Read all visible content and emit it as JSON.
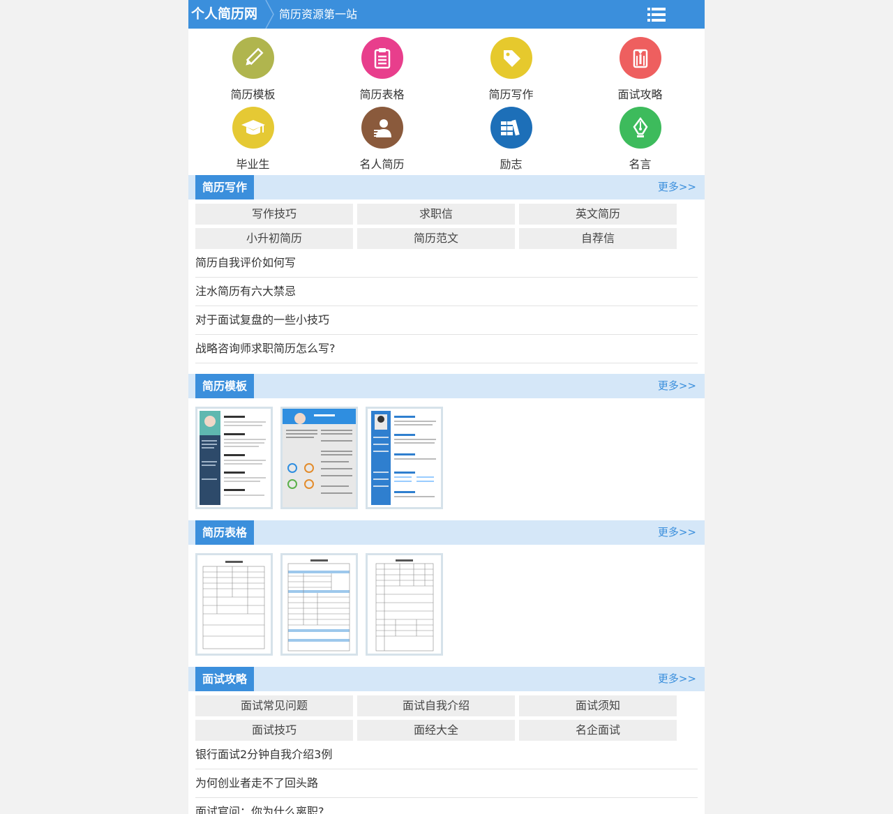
{
  "header": {
    "logo_text": "个人简历网",
    "tagline": "简历资源第一站",
    "menu_icon": "list-menu-icon"
  },
  "nav": [
    {
      "label": "简历模板",
      "icon": "pencil-icon",
      "color": "#b0b54e"
    },
    {
      "label": "简历表格",
      "icon": "clipboard-icon",
      "color": "#e83e8c"
    },
    {
      "label": "简历写作",
      "icon": "tag-icon",
      "color": "#e6c92d"
    },
    {
      "label": "面试攻略",
      "icon": "suit-icon",
      "color": "#ee5f5f"
    },
    {
      "label": "毕业生",
      "icon": "graduation-cap-icon",
      "color": "#e5c934"
    },
    {
      "label": "名人简历",
      "icon": "person-icon",
      "color": "#8a5a3c"
    },
    {
      "label": "励志",
      "icon": "books-icon",
      "color": "#1d6fb8"
    },
    {
      "label": "名言",
      "icon": "pen-nib-icon",
      "color": "#3dbb5c"
    }
  ],
  "sections": {
    "writing": {
      "title": "简历写作",
      "more": "更多>>",
      "tags": [
        "写作技巧",
        "求职信",
        "英文简历",
        "小升初简历",
        "简历范文",
        "自荐信"
      ],
      "articles": [
        "简历自我评价如何写",
        "注水简历有六大禁忌",
        "对于面试复盘的一些小技巧",
        "战略咨询师求职简历怎么写?"
      ]
    },
    "templates": {
      "title": "简历模板",
      "more": "更多>>"
    },
    "forms": {
      "title": "简历表格",
      "more": "更多>>"
    },
    "interview": {
      "title": "面试攻略",
      "more": "更多>>",
      "tags": [
        "面试常见问题",
        "面试自我介绍",
        "面试须知",
        "面试技巧",
        "面经大全",
        "名企面试"
      ],
      "articles": [
        "银行面试2分钟自我介绍3例",
        "为何创业者走不了回头路",
        "面试官问：你为什么离职?"
      ]
    }
  },
  "colors": {
    "brand": "#3b8fdc",
    "section_bg": "#d5e7f8",
    "tag_bg": "#eeeeee"
  }
}
